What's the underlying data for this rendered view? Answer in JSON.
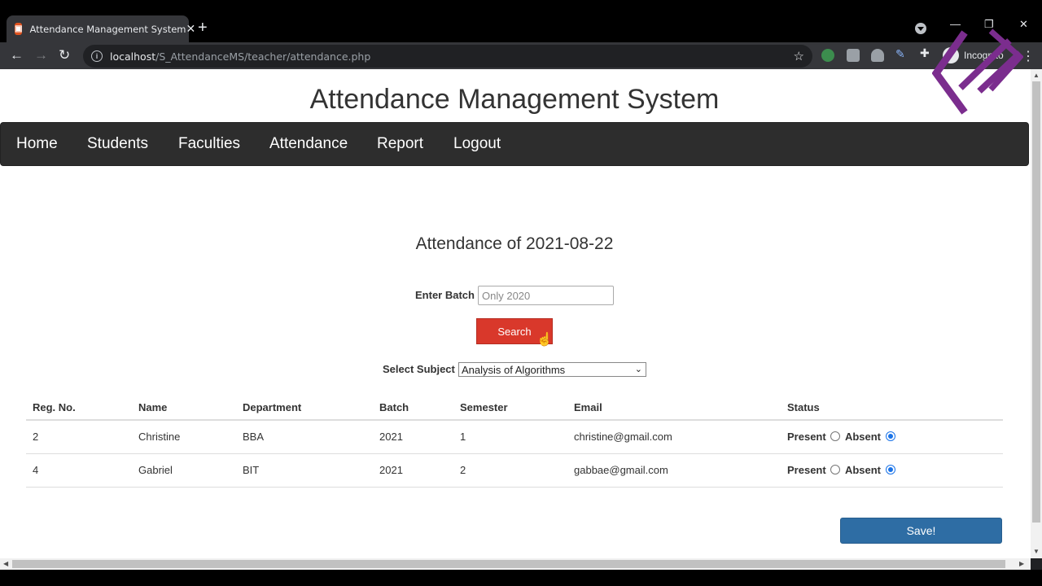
{
  "browser": {
    "tab_title": "Attendance Management System",
    "url_host": "localhost",
    "url_path": "/S_AttendanceMS/teacher/attendance.php",
    "profile_label": "Incognito"
  },
  "page": {
    "site_title": "Attendance Management System",
    "nav": [
      "Home",
      "Students",
      "Faculties",
      "Attendance",
      "Report",
      "Logout"
    ],
    "heading": "Attendance of 2021-08-22",
    "batch_label": "Enter Batch",
    "batch_placeholder": "Only 2020",
    "search_label": "Search",
    "subject_label": "Select Subject",
    "subject_selected": "Analysis of Algorithms",
    "columns": [
      "Reg. No.",
      "Name",
      "Department",
      "Batch",
      "Semester",
      "Email",
      "Status"
    ],
    "rows": [
      {
        "reg": "2",
        "name": "Christine",
        "dept": "BBA",
        "batch": "2021",
        "semester": "1",
        "email": "christine@gmail.com",
        "present": false,
        "absent": true
      },
      {
        "reg": "4",
        "name": "Gabriel",
        "dept": "BIT",
        "batch": "2021",
        "semester": "2",
        "email": "gabbae@gmail.com",
        "present": false,
        "absent": true
      }
    ],
    "present_label": "Present",
    "absent_label": "Absent",
    "save_label": "Save!"
  },
  "colors": {
    "navbar": "#2d2d2d",
    "search_button": "#d9382b",
    "save_button": "#2e6da4",
    "logo": "#7b2d8e"
  }
}
